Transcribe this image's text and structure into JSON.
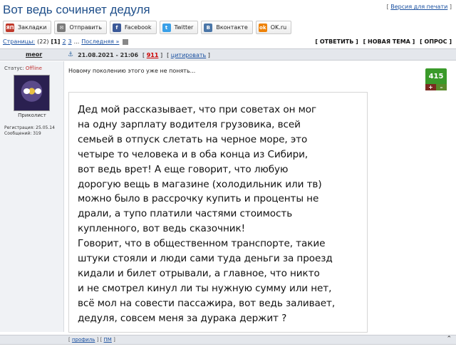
{
  "topic": {
    "title": "Вот ведь сочиняет дедуля",
    "print_label": "Версия для печати"
  },
  "share": [
    {
      "label": "Закладки",
      "icon": "bookmarks-icon",
      "icon_text": "ЯП",
      "color": "#c0392b"
    },
    {
      "label": "Отправить",
      "icon": "mail-icon",
      "icon_text": "✉",
      "color": "#7a7a7a"
    },
    {
      "label": "Facebook",
      "icon": "facebook-icon",
      "icon_text": "f",
      "color": "#3b5998"
    },
    {
      "label": "Twitter",
      "icon": "twitter-icon",
      "icon_text": "t",
      "color": "#3aa0e8"
    },
    {
      "label": "Вконтакте",
      "icon": "vk-icon",
      "icon_text": "B",
      "color": "#4a76a8"
    },
    {
      "label": "OK.ru",
      "icon": "ok-icon",
      "icon_text": "ok",
      "color": "#ee8208"
    }
  ],
  "pager": {
    "label": "Страницы:",
    "total": "(22)",
    "current": "[1]",
    "p2": "2",
    "p3": "3",
    "dots": "...",
    "last": "Последняя »"
  },
  "actions": {
    "reply": "[ ОТВЕТИТЬ ]",
    "new_topic": "[ НОВАЯ ТЕМА ]",
    "poll": "[ ОПРОС ]"
  },
  "post": {
    "author": "meor",
    "anchor": "⚓",
    "date": "21.08.2021 - 21:06",
    "number": "911",
    "quote": "цитировать",
    "status_label": "Статус:",
    "status_value": "Offline",
    "rank": "Приколист",
    "reg": "Регистрация: 25.05.14",
    "messages": "Сообщений: 319",
    "text": "Новому поколению этого уже не понять...",
    "rating": "415",
    "plus": "+",
    "minus": "–",
    "image_lines": [
      "Дед мой рассказывает, что при советах он мог",
      "на одну зарплату водителя грузовика, всей",
      "семьей в отпуск слетать на черное море, это",
      "четыре то человека и в оба конца из Сибири,",
      "вот ведь врет! А еще говорит, что любую",
      "дорогую вещь в магазине (холодильник или тв)",
      "можно было в рассрочку купить и проценты не",
      "драли, а тупо платили частями стоимость",
      "купленного, вот ведь сказочник!",
      "Говорит, что в общественном транспорте, такие",
      "штуки стояли и люди сами туда деньги за проезд",
      "кидали и билет отрывали, а главное, что никто",
      "и не смотрел кинул ли ты нужную сумму или нет,",
      "всё мол на совести пассажира, вот ведь заливает,",
      "дедуля, совсем меня за дурака держит ?"
    ]
  },
  "footer": {
    "profile": "профиль",
    "pm": "ПМ",
    "up": "⌃"
  }
}
